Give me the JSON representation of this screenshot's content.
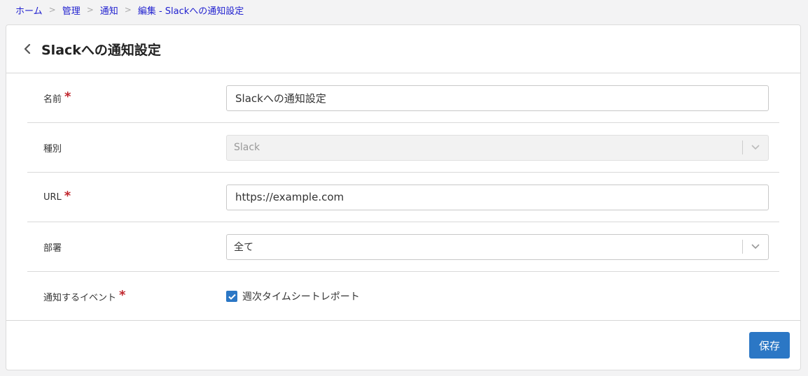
{
  "breadcrumb": {
    "items": [
      "ホーム",
      "管理",
      "通知",
      "編集 - Slackへの通知設定"
    ],
    "separator": ">"
  },
  "header": {
    "title": "Slackへの通知設定",
    "back_icon": "chevron-left-icon"
  },
  "form": {
    "name": {
      "label": "名前",
      "required_mark": "*",
      "value": "Slackへの通知設定"
    },
    "type": {
      "label": "種別",
      "value": "Slack",
      "disabled": true
    },
    "url": {
      "label": "URL",
      "required_mark": "*",
      "value": "https://example.com"
    },
    "department": {
      "label": "部署",
      "value": "全て"
    },
    "events": {
      "label": "通知するイベント",
      "required_mark": "*",
      "option_label": "週次タイムシートレポート",
      "checked": true
    }
  },
  "footer": {
    "save_label": "保存"
  },
  "colors": {
    "accent": "#2b77c5",
    "required": "#c0262d",
    "link": "#1f1fcf"
  }
}
